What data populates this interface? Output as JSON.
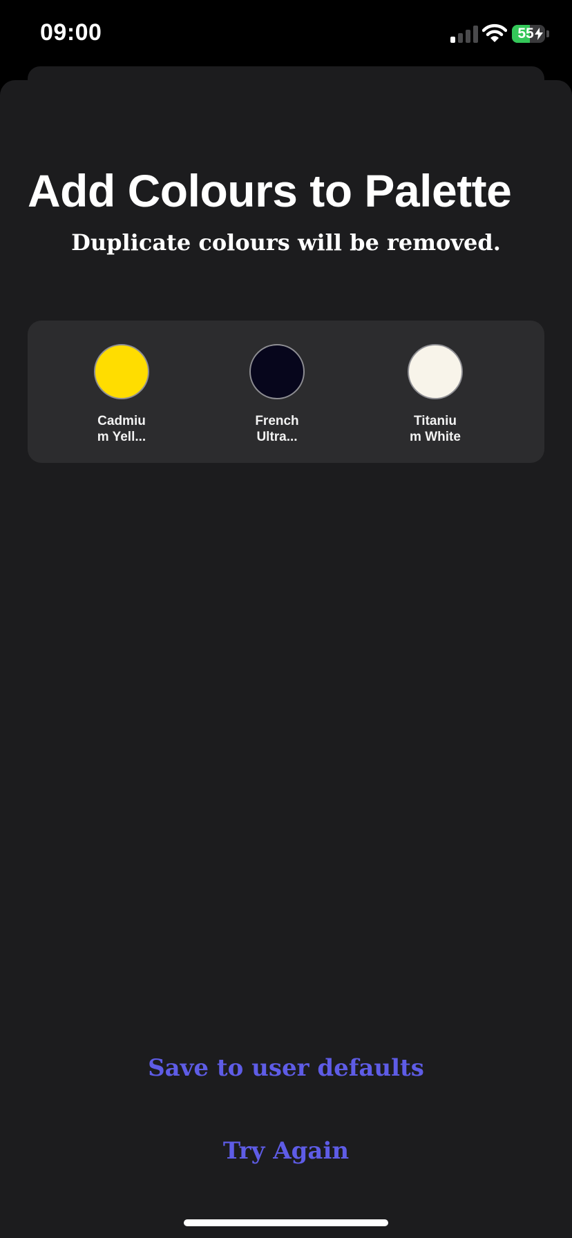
{
  "status_bar": {
    "time": "09:00",
    "battery_text": "55",
    "battery_level": 0.55,
    "battery_color": "#34c759",
    "icons": [
      "cellular-signal-icon",
      "wifi-icon",
      "battery-icon",
      "charging-bolt-icon"
    ]
  },
  "sheet": {
    "title": "Add Colours to Palette",
    "subtitle": "Duplicate colours will be removed."
  },
  "swatches": [
    {
      "name_line1": "Cadmiu",
      "name_line2": "m Yell...",
      "color": "#ffdd00"
    },
    {
      "name_line1": "French",
      "name_line2": "Ultra...",
      "color": "#07061c"
    },
    {
      "name_line1": "Titaniu",
      "name_line2": "m White",
      "color": "#f8f4ea"
    }
  ],
  "actions": {
    "save_label": "Save to user defaults",
    "try_again_label": "Try Again"
  },
  "colors": {
    "background": "#1c1c1e",
    "panel": "#2c2c2e",
    "accent": "#5e5ce6"
  }
}
